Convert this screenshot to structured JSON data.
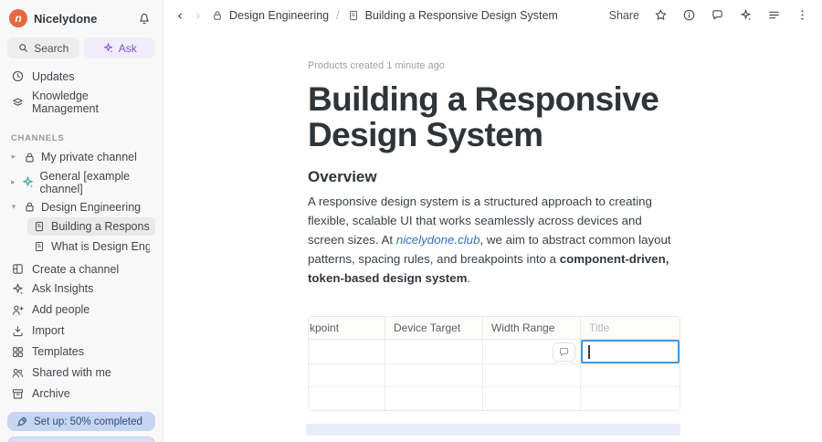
{
  "colors": {
    "logo_orange": "#e8683f",
    "ask_purple": "#7a55d4",
    "focus_blue": "#4697d8",
    "setup_banner_bg": "#c6d5f1",
    "selection_strip": "#e7edf8"
  },
  "sidebar": {
    "workspace_name": "Nicelydone",
    "search_label": "Search",
    "ask_label": "Ask",
    "nav_items": [
      {
        "label": "Updates",
        "icon": "clock-icon"
      },
      {
        "label": "Knowledge Management",
        "icon": "layers-icon"
      }
    ],
    "channels_header": "CHANNELS",
    "channels": [
      {
        "label": "My private channel",
        "state": "collapsed",
        "icon": "lock-icon"
      },
      {
        "label": "General [example channel]",
        "state": "collapsed",
        "icon": "sparkle-teal-icon"
      },
      {
        "label": "Design Engineering",
        "state": "expanded",
        "icon": "lock-icon"
      }
    ],
    "pages": [
      {
        "label": "Building a Responsive De..",
        "selected": true
      },
      {
        "label": "What is Design Engineerin..",
        "selected": false
      }
    ],
    "create_channel_label": "Create a channel",
    "footer_items": [
      {
        "label": "Ask Insights",
        "icon": "sparkle-icon"
      },
      {
        "label": "Add people",
        "icon": "person-plus-icon"
      },
      {
        "label": "Import",
        "icon": "import-icon"
      },
      {
        "label": "Templates",
        "icon": "templates-icon"
      },
      {
        "label": "Shared with me",
        "icon": "people-icon"
      },
      {
        "label": "Archive",
        "icon": "archive-icon"
      }
    ],
    "setup_banner_label": "Set up: 50% completed"
  },
  "topbar": {
    "breadcrumb_channel": "Design Engineering",
    "breadcrumb_separator": "/",
    "breadcrumb_page": "Building a Responsive Design System",
    "share_label": "Share"
  },
  "content": {
    "meta_text": "Products created 1 minute ago",
    "page_title": "Building a Responsive Design System",
    "section_heading": "Overview",
    "paragraph": {
      "part1": "A responsive design system is a structured approach to creating flexible, scalable UI that works seamlessly across devices and screen sizes. At ",
      "link_text": "nicelydone.club",
      "part2": ", we aim to abstract common layout patterns, spacing rules, and breakpoints into a ",
      "bold_text": "component-driven, token-based design system",
      "part3": "."
    },
    "table": {
      "headers": [
        {
          "label": "kpoint",
          "note": "truncated-left"
        },
        {
          "label": "Device Target"
        },
        {
          "label": "Width Range"
        },
        {
          "label": "Title",
          "note": "new-column-placeholder"
        }
      ],
      "row_count": 3,
      "focused_cell": {
        "row": 1,
        "column": "Title",
        "value": ""
      }
    }
  }
}
